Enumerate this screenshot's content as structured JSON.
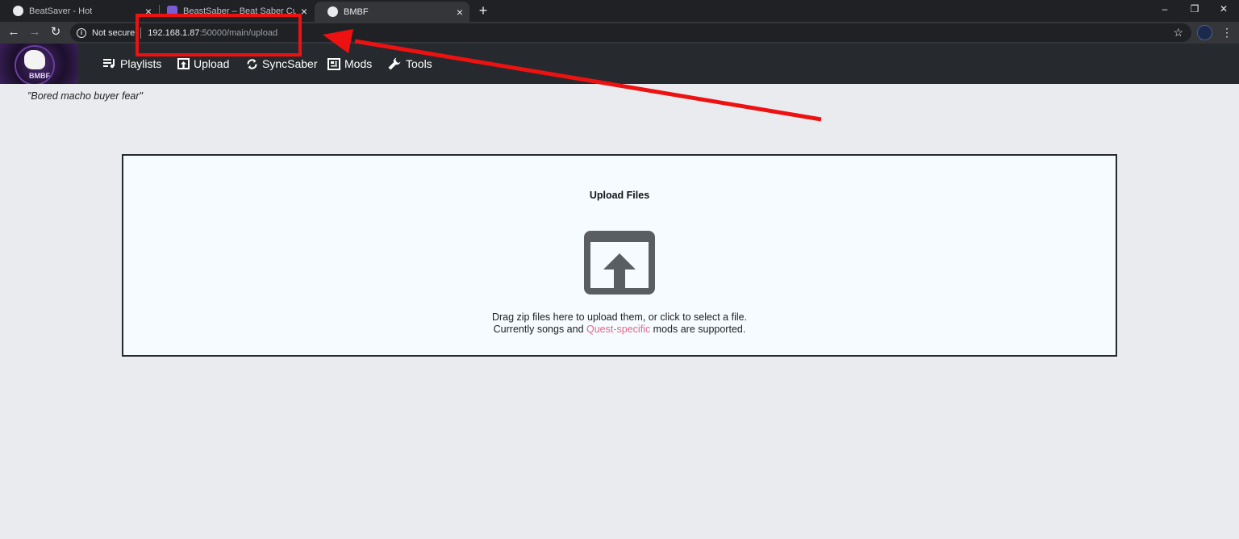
{
  "browser": {
    "tabs": [
      {
        "title": "BeatSaver - Hot",
        "active": false
      },
      {
        "title": "BeastSaber – Beat Saber Custom",
        "active": false
      },
      {
        "title": "BMBF",
        "active": true
      }
    ],
    "newtab_glyph": "+",
    "close_glyph": "×",
    "window_controls": {
      "minimize": "–",
      "restore": "❐",
      "close": "✕"
    },
    "nav": {
      "back": "←",
      "forward": "→",
      "reload": "↻"
    },
    "address": {
      "security_label": "Not secure",
      "host": "192.168.1.87",
      "path": ":50000/main/upload"
    },
    "star_glyph": "☆",
    "menu_glyph": "⋮"
  },
  "app": {
    "logo_text": "BMBF",
    "nav": [
      {
        "label": "Playlists",
        "icon": "playlist-icon"
      },
      {
        "label": "Upload",
        "icon": "upload-icon"
      },
      {
        "label": "SyncSaber",
        "icon": "sync-icon"
      },
      {
        "label": "Mods",
        "icon": "mods-icon"
      },
      {
        "label": "Tools",
        "icon": "wrench-icon"
      }
    ],
    "quote": "\"Bored macho buyer fear\"",
    "upload": {
      "title": "Upload Files",
      "line1": "Drag zip files here to upload them, or click to select a file.",
      "line2_prefix": "Currently songs and ",
      "line2_link": "Quest-specific",
      "line2_suffix": " mods are supported."
    }
  },
  "colors": {
    "annotation": "#ee1111",
    "link": "#e0688a",
    "navbar": "#262a2e",
    "background": "#e9ebee",
    "dropzone": "#f5fbff"
  }
}
